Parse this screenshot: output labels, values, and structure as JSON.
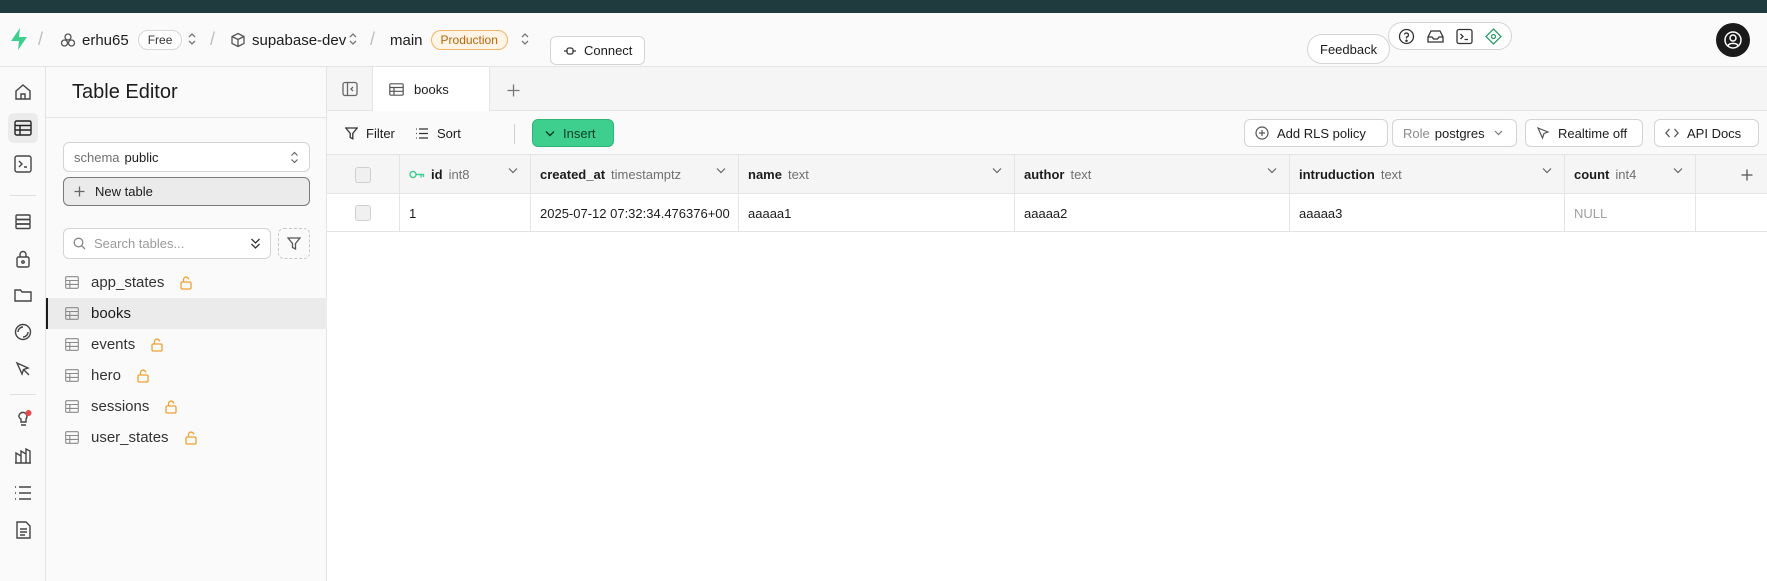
{
  "topnav": {
    "org_name": "erhu65",
    "plan_badge": "Free",
    "project_name": "supabase-dev",
    "branch_name": "main",
    "env_badge": "Production",
    "connect_label": "Connect",
    "feedback_label": "Feedback"
  },
  "sidebar": {
    "title": "Table Editor",
    "schema_label": "schema",
    "schema_value": "public",
    "new_table_label": "New table",
    "search_placeholder": "Search tables...",
    "tables": [
      {
        "name": "app_states",
        "locked": true
      },
      {
        "name": "books",
        "locked": false,
        "active": true
      },
      {
        "name": "events",
        "locked": true
      },
      {
        "name": "hero",
        "locked": true
      },
      {
        "name": "sessions",
        "locked": true
      },
      {
        "name": "user_states",
        "locked": true
      }
    ]
  },
  "tabs": [
    {
      "label": "books"
    }
  ],
  "toolbar": {
    "filter_label": "Filter",
    "sort_label": "Sort",
    "insert_label": "Insert",
    "rls_label": "Add RLS policy",
    "role_label": "Role",
    "role_value": "postgres",
    "realtime_label": "Realtime off",
    "api_docs_label": "API Docs"
  },
  "grid": {
    "columns": [
      {
        "name": "id",
        "type": "int8",
        "primary_key": true
      },
      {
        "name": "created_at",
        "type": "timestamptz"
      },
      {
        "name": "name",
        "type": "text"
      },
      {
        "name": "author",
        "type": "text"
      },
      {
        "name": "intruduction",
        "type": "text"
      },
      {
        "name": "count",
        "type": "int4"
      }
    ],
    "rows": [
      [
        "1",
        "2025-07-12 07:32:34.476376+00",
        "aaaaa1",
        "aaaaa2",
        "aaaaa3",
        "NULL"
      ]
    ]
  },
  "colors": {
    "brand_green": "#3ecf8e",
    "production_orange": "#b8650a",
    "lock_orange": "#f0a030"
  }
}
